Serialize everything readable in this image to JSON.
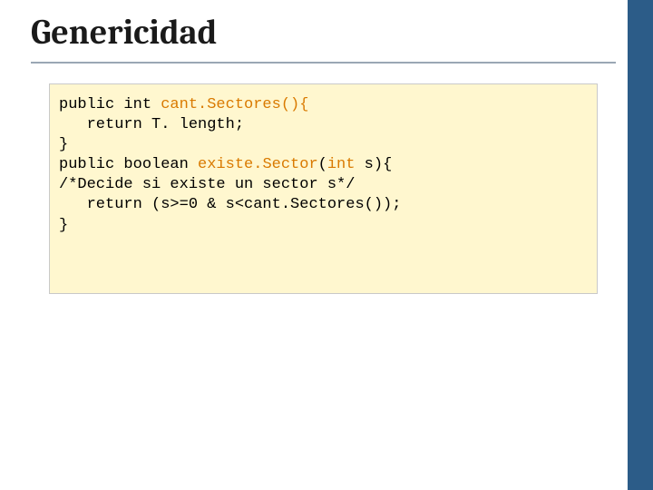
{
  "slide": {
    "title": "Genericidad",
    "code": {
      "line1a": "public int ",
      "line1b": "cant.Sectores(){",
      "line2": "   return T. length;",
      "line3": "}",
      "line4a": "public boolean ",
      "line4b": "existe.Sector",
      "line4c": "(",
      "line4d": "int ",
      "line4e": "s){",
      "line5": "/*Decide si existe un sector s*/",
      "line6": "   return (s>=0 & s<cant.Sectores());",
      "line7": "}"
    }
  }
}
